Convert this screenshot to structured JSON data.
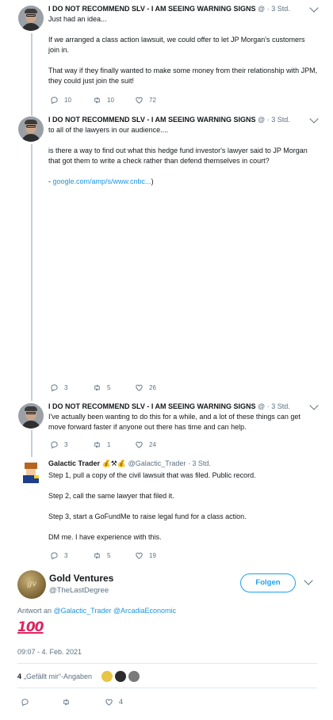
{
  "tweets": [
    {
      "name": "I DO NOT RECOMMEND SLV - I AM SEEING WARNING SIGNS",
      "handle": "@",
      "sep": "·",
      "time": "3 Std.",
      "paragraphs": [
        "Just had an idea...",
        "If we arranged a class action lawsuit, we could offer to let JP Morgan's customers join in.",
        "That way if they finally wanted to make some money from their relationship with JPM, they could just join the suit!"
      ],
      "replies": "10",
      "retweets": "10",
      "likes": "72"
    },
    {
      "name": "I DO NOT RECOMMEND SLV - I AM SEEING WARNING SIGNS",
      "handle": "@",
      "sep": "·",
      "time": "3 Std.",
      "paragraphs": [
        "to all of the lawyers in our audience....",
        "is there a way to find out what this hedge fund investor's lawyer said to JP Morgan that got them to write a check rather than defend themselves in court?"
      ],
      "link_prefix": "- ",
      "link_text": "google.com/amp/s/www.cnbc...",
      "link_suffix": ")",
      "replies": "3",
      "retweets": "5",
      "likes": "26"
    },
    {
      "name": "I DO NOT RECOMMEND SLV - I AM SEEING WARNING SIGNS",
      "handle": "@",
      "sep": "·",
      "time": "3 Std.",
      "paragraphs": [
        "I've actually been wanting to do this for a while, and a lot of these things can get move forward faster if anyone out there has time and can help."
      ],
      "replies": "3",
      "retweets": "1",
      "likes": "24"
    },
    {
      "name": "Galactic Trader",
      "name_emoji": "💰⚒💰",
      "handle": "@Galactic_Trader",
      "sep": "·",
      "time": "3 Std.",
      "paragraphs": [
        "Step 1, pull a copy of the civil lawsuit that was filed. Public record.",
        "Step 2, call the same lawyer that filed it.",
        "Step 3, start a GoFundMe to raise legal fund for a class action.",
        "DM me. I have experience with this."
      ],
      "replies": "3",
      "retweets": "5",
      "likes": "19"
    }
  ],
  "focus": {
    "avatar_text": "gv",
    "name": "Gold Ventures",
    "handle": "@TheLastDegree",
    "follow_label": "Folgen",
    "reply_prefix": "Antwort an ",
    "reply_mention_1": "@Galactic_Trader",
    "reply_mention_2": "@ArcadiaEconomic",
    "body_emoji": "100",
    "timestamp": "09:07 - 4. Feb. 2021",
    "likes_count": "4",
    "likes_label": "„Gefällt mir“-Angaben",
    "bottom_like_count": "4"
  },
  "icons": {
    "reply": "reply-icon",
    "retweet": "retweet-icon",
    "like": "heart-icon",
    "more": "chevron-down-icon"
  },
  "colors": {
    "link": "#1b95e0",
    "follow": "#1da1f2",
    "muted": "#5b7083",
    "thread_line": "#c4cfd6"
  }
}
